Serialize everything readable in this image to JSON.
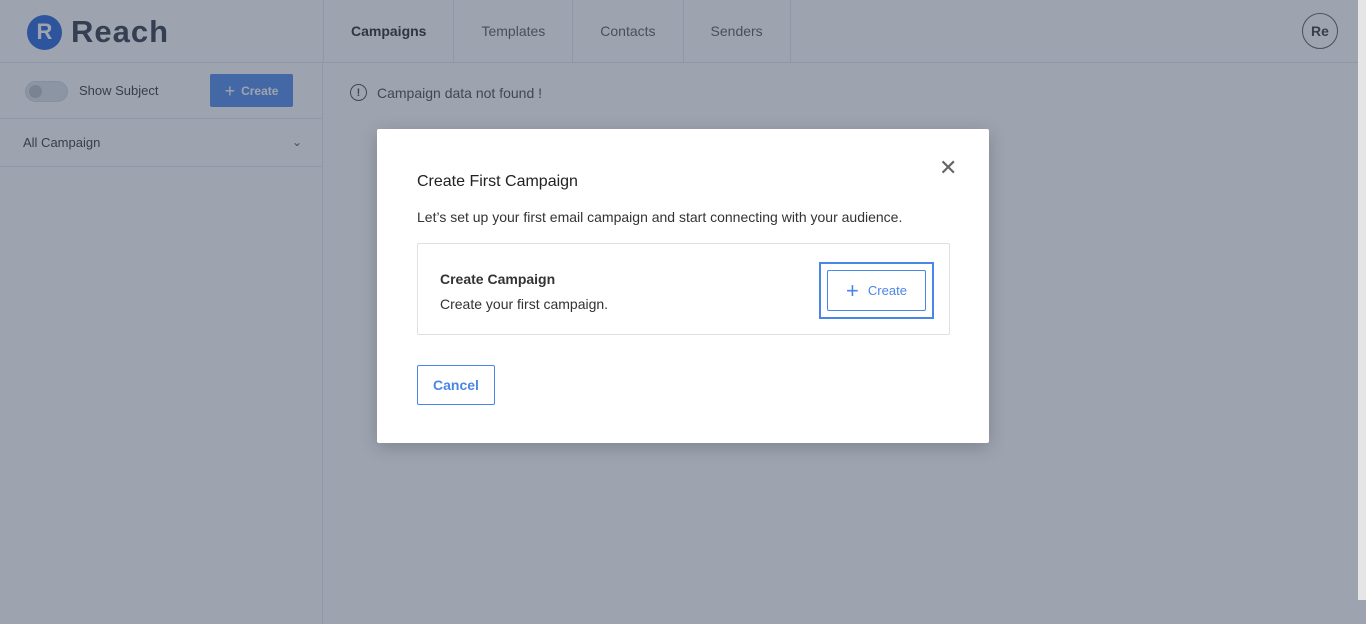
{
  "app": {
    "logo_letter": "R",
    "logo_text": "Reach"
  },
  "nav": {
    "items": [
      "Campaigns",
      "Templates",
      "Contacts",
      "Senders"
    ]
  },
  "user": {
    "avatar_initials": "Re"
  },
  "sidebar": {
    "show_subject_label": "Show Subject",
    "create_label": "Create",
    "filter_label": "All Campaign"
  },
  "main": {
    "empty_message": "Campaign data not found !"
  },
  "modal": {
    "title": "Create First Campaign",
    "description": "Let’s set up your first email campaign and start connecting with your audience.",
    "card_title": "Create Campaign",
    "card_subtitle": "Create your first campaign.",
    "create_label": "Create",
    "cancel_label": "Cancel"
  },
  "colors": {
    "accent": "#4a86e8",
    "logo": "#1f5fd6"
  }
}
